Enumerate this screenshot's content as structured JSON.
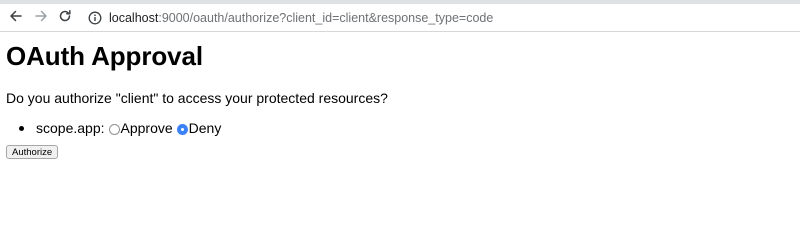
{
  "browser": {
    "url_host": "localhost",
    "url_rest": ":9000/oauth/authorize?client_id=client&response_type=code",
    "icons": {
      "back": "arrow-left-icon",
      "forward": "arrow-right-icon",
      "reload": "reload-icon",
      "site_info": "info-icon"
    }
  },
  "page": {
    "title": "OAuth Approval",
    "question": "Do you authorize \"client\" to access your protected resources?",
    "scopes": [
      {
        "label": "scope.app:",
        "options": [
          {
            "label": "Approve",
            "checked": false
          },
          {
            "label": "Deny",
            "checked": true
          }
        ]
      }
    ],
    "submit_label": "Authorize"
  },
  "colors": {
    "radio_checked": "#3b82f6",
    "url_muted": "#6e7175"
  }
}
